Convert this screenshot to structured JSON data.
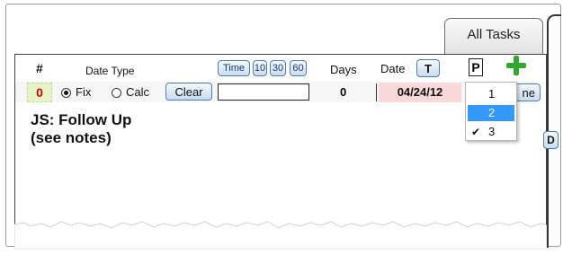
{
  "tab": {
    "label": "All Tasks"
  },
  "header": {
    "number_label": "#",
    "date_type_label": "Date Type",
    "time_buttons": [
      "Time",
      "10",
      "30",
      "60"
    ],
    "days_label": "Days",
    "date_label": "Date",
    "today_button": "T",
    "priority_label": "P",
    "add_icon": "plus-icon"
  },
  "row": {
    "number": "0",
    "fix_label": "Fix",
    "calc_label": "Calc",
    "date_type_selected": "Fix",
    "clear_label": "Clear",
    "time_value": "",
    "days": "0",
    "date": "04/24/12",
    "done_partial": "ne",
    "task_title_line1": "JS: Follow Up",
    "task_title_line2": "(see notes)",
    "d_button": "D"
  },
  "priority_dropdown": {
    "options": [
      "1",
      "2",
      "3"
    ],
    "highlighted": "2",
    "checked": "3",
    "check_mark": "✔"
  },
  "colors": {
    "number_bg": "#e6f5c8",
    "number_text": "#e00000",
    "date_bg": "#f8d8d8",
    "button_border": "#4a7fb5",
    "selection": "#3399ff",
    "plus": "#2ea82e"
  }
}
